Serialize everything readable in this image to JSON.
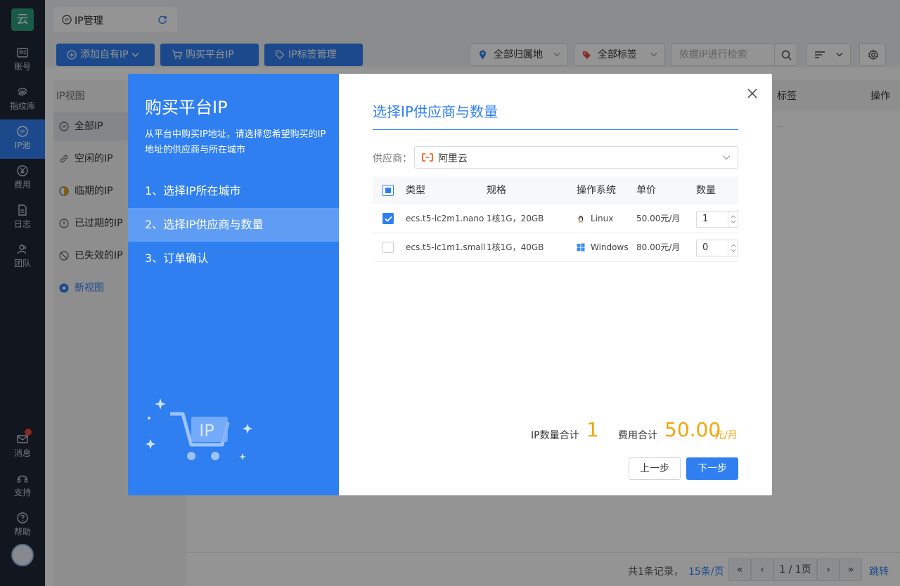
{
  "nav": {
    "logo": "云",
    "items": [
      {
        "label": "账号",
        "icon": "account-icon"
      },
      {
        "label": "指纹库",
        "icon": "fingerprint-icon"
      },
      {
        "label": "IP池",
        "icon": "ip-pool-icon"
      },
      {
        "label": "费用",
        "icon": "yen-icon"
      },
      {
        "label": "日志",
        "icon": "log-icon"
      },
      {
        "label": "团队",
        "icon": "team-icon"
      }
    ],
    "bottom": [
      {
        "label": "消息",
        "icon": "mail-icon"
      },
      {
        "label": "支持",
        "icon": "headset-icon"
      },
      {
        "label": "帮助",
        "icon": "help-icon"
      }
    ]
  },
  "tab": {
    "label": "IP管理"
  },
  "toolbar": {
    "add_own": "添加自有IP",
    "buy": "购买平台IP",
    "tags": "IP标签管理",
    "region": "全部归属地",
    "all_tags": "全部标签",
    "search_placeholder": "依据IP进行检索"
  },
  "views": {
    "heading": "IP视图",
    "items": [
      "全部IP",
      "空闲的IP",
      "临期的IP",
      "已过期的IP",
      "已失效的IP"
    ],
    "new_view": "新视图"
  },
  "table": {
    "col_tags": "标签",
    "col_actions": "操作",
    "empty_cell": "--"
  },
  "pager": {
    "total": "共1条记录，",
    "per_page": "15条/页",
    "page": "1 / 1页",
    "jump": "跳转"
  },
  "dialog": {
    "title": "购买平台IP",
    "description": "从平台中购买IP地址，请选择您希望购买的IP地址的供应商与所在城市",
    "steps": [
      "1、选择IP所在城市",
      "2、选择IP供应商与数量",
      "3、订单确认"
    ],
    "active_step": 1,
    "section_title": "选择IP供应商与数量",
    "provider_label": "供应商：",
    "provider_value": "阿里云",
    "columns": [
      "类型",
      "规格",
      "操作系统",
      "单价",
      "数量"
    ],
    "rows": [
      {
        "type": "ecs.t5-lc2m1.nano",
        "spec": "1核1G，20GB",
        "os": "Linux",
        "price": "50.00元/月",
        "qty": "1",
        "checked": true
      },
      {
        "type": "ecs.t5-lc1m1.small",
        "spec": "1核1G，40GB",
        "os": "Windows",
        "price": "80.00元/月",
        "qty": "0",
        "checked": false
      }
    ],
    "ip_total_label": "IP数量合计",
    "ip_total_value": "1",
    "cost_label": "费用合计",
    "cost_value": "50.00",
    "cost_unit": "元/月",
    "prev": "上一步",
    "next": "下一步",
    "art_text": "IP"
  },
  "colors": {
    "primary": "#2f7ff0",
    "accent": "#f2a60a",
    "nav_bg": "#1f2634"
  }
}
